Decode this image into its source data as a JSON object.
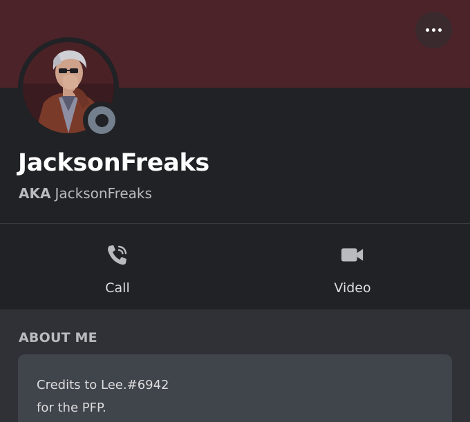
{
  "profile": {
    "username": "JacksonFreaks",
    "aka_label": "AKA",
    "aka_name": "JacksonFreaks",
    "status": "offline"
  },
  "header": {
    "more_icon": "more-horizontal-icon"
  },
  "actions": {
    "call": {
      "label": "Call",
      "icon": "phone-icon"
    },
    "video": {
      "label": "Video",
      "icon": "video-camera-icon"
    }
  },
  "about": {
    "heading": "ABOUT ME",
    "lines": [
      "Credits to Lee.#6942",
      "for the PFP."
    ]
  },
  "colors": {
    "banner": "#4b2329",
    "card": "#202225",
    "background": "#2f3136",
    "status_offline": "#747f8d"
  }
}
